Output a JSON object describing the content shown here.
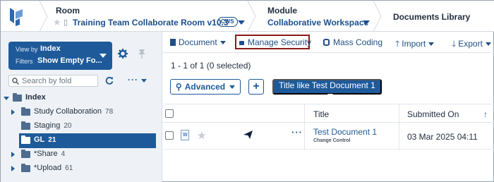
{
  "header": {
    "room_label": "Room",
    "room_name": "Training Team Collaborate Room v10.3",
    "room_badge": "CWS",
    "module_label": "Module",
    "module_name": "Collaborative Workspace",
    "library_label": "Documents Library"
  },
  "sidebar": {
    "view_by_label": "View by",
    "view_by_value": "Index",
    "filters_label": "Filters",
    "filters_value": "Show Empty Fo...",
    "search_placeholder": "Search by fold",
    "tree": [
      {
        "label": "Index",
        "count": "",
        "expanded": true
      },
      {
        "label": "Study Collaboration",
        "count": "78"
      },
      {
        "label": "Staging",
        "count": "20"
      },
      {
        "label": "GL",
        "count": "21",
        "selected": true
      },
      {
        "label": "*Share",
        "count": "4"
      },
      {
        "label": "*Upload",
        "count": "61"
      }
    ]
  },
  "toolbar": {
    "document": "Document",
    "manage_security": "Manage Security",
    "mass_coding": "Mass Coding",
    "import": "Import",
    "export": "Export"
  },
  "results": {
    "count_text": "1 - 1 of 1 (0 selected)",
    "advanced_button": "Advanced",
    "plus_button": "+",
    "filter_chip": "Title like Test Document 1"
  },
  "grid": {
    "columns": [
      "Title",
      "Submitted On"
    ],
    "sort_indicator": "↑",
    "rows": [
      {
        "title": "Test Document 1",
        "subtitle": "Change Control",
        "submitted_on": "03 Mar 2025 04:11",
        "file_type": "W"
      }
    ]
  },
  "colors": {
    "primary": "#1e5a9a",
    "highlight_border": "#8b1a1a",
    "sidebar_bg": "#eef2f6"
  }
}
